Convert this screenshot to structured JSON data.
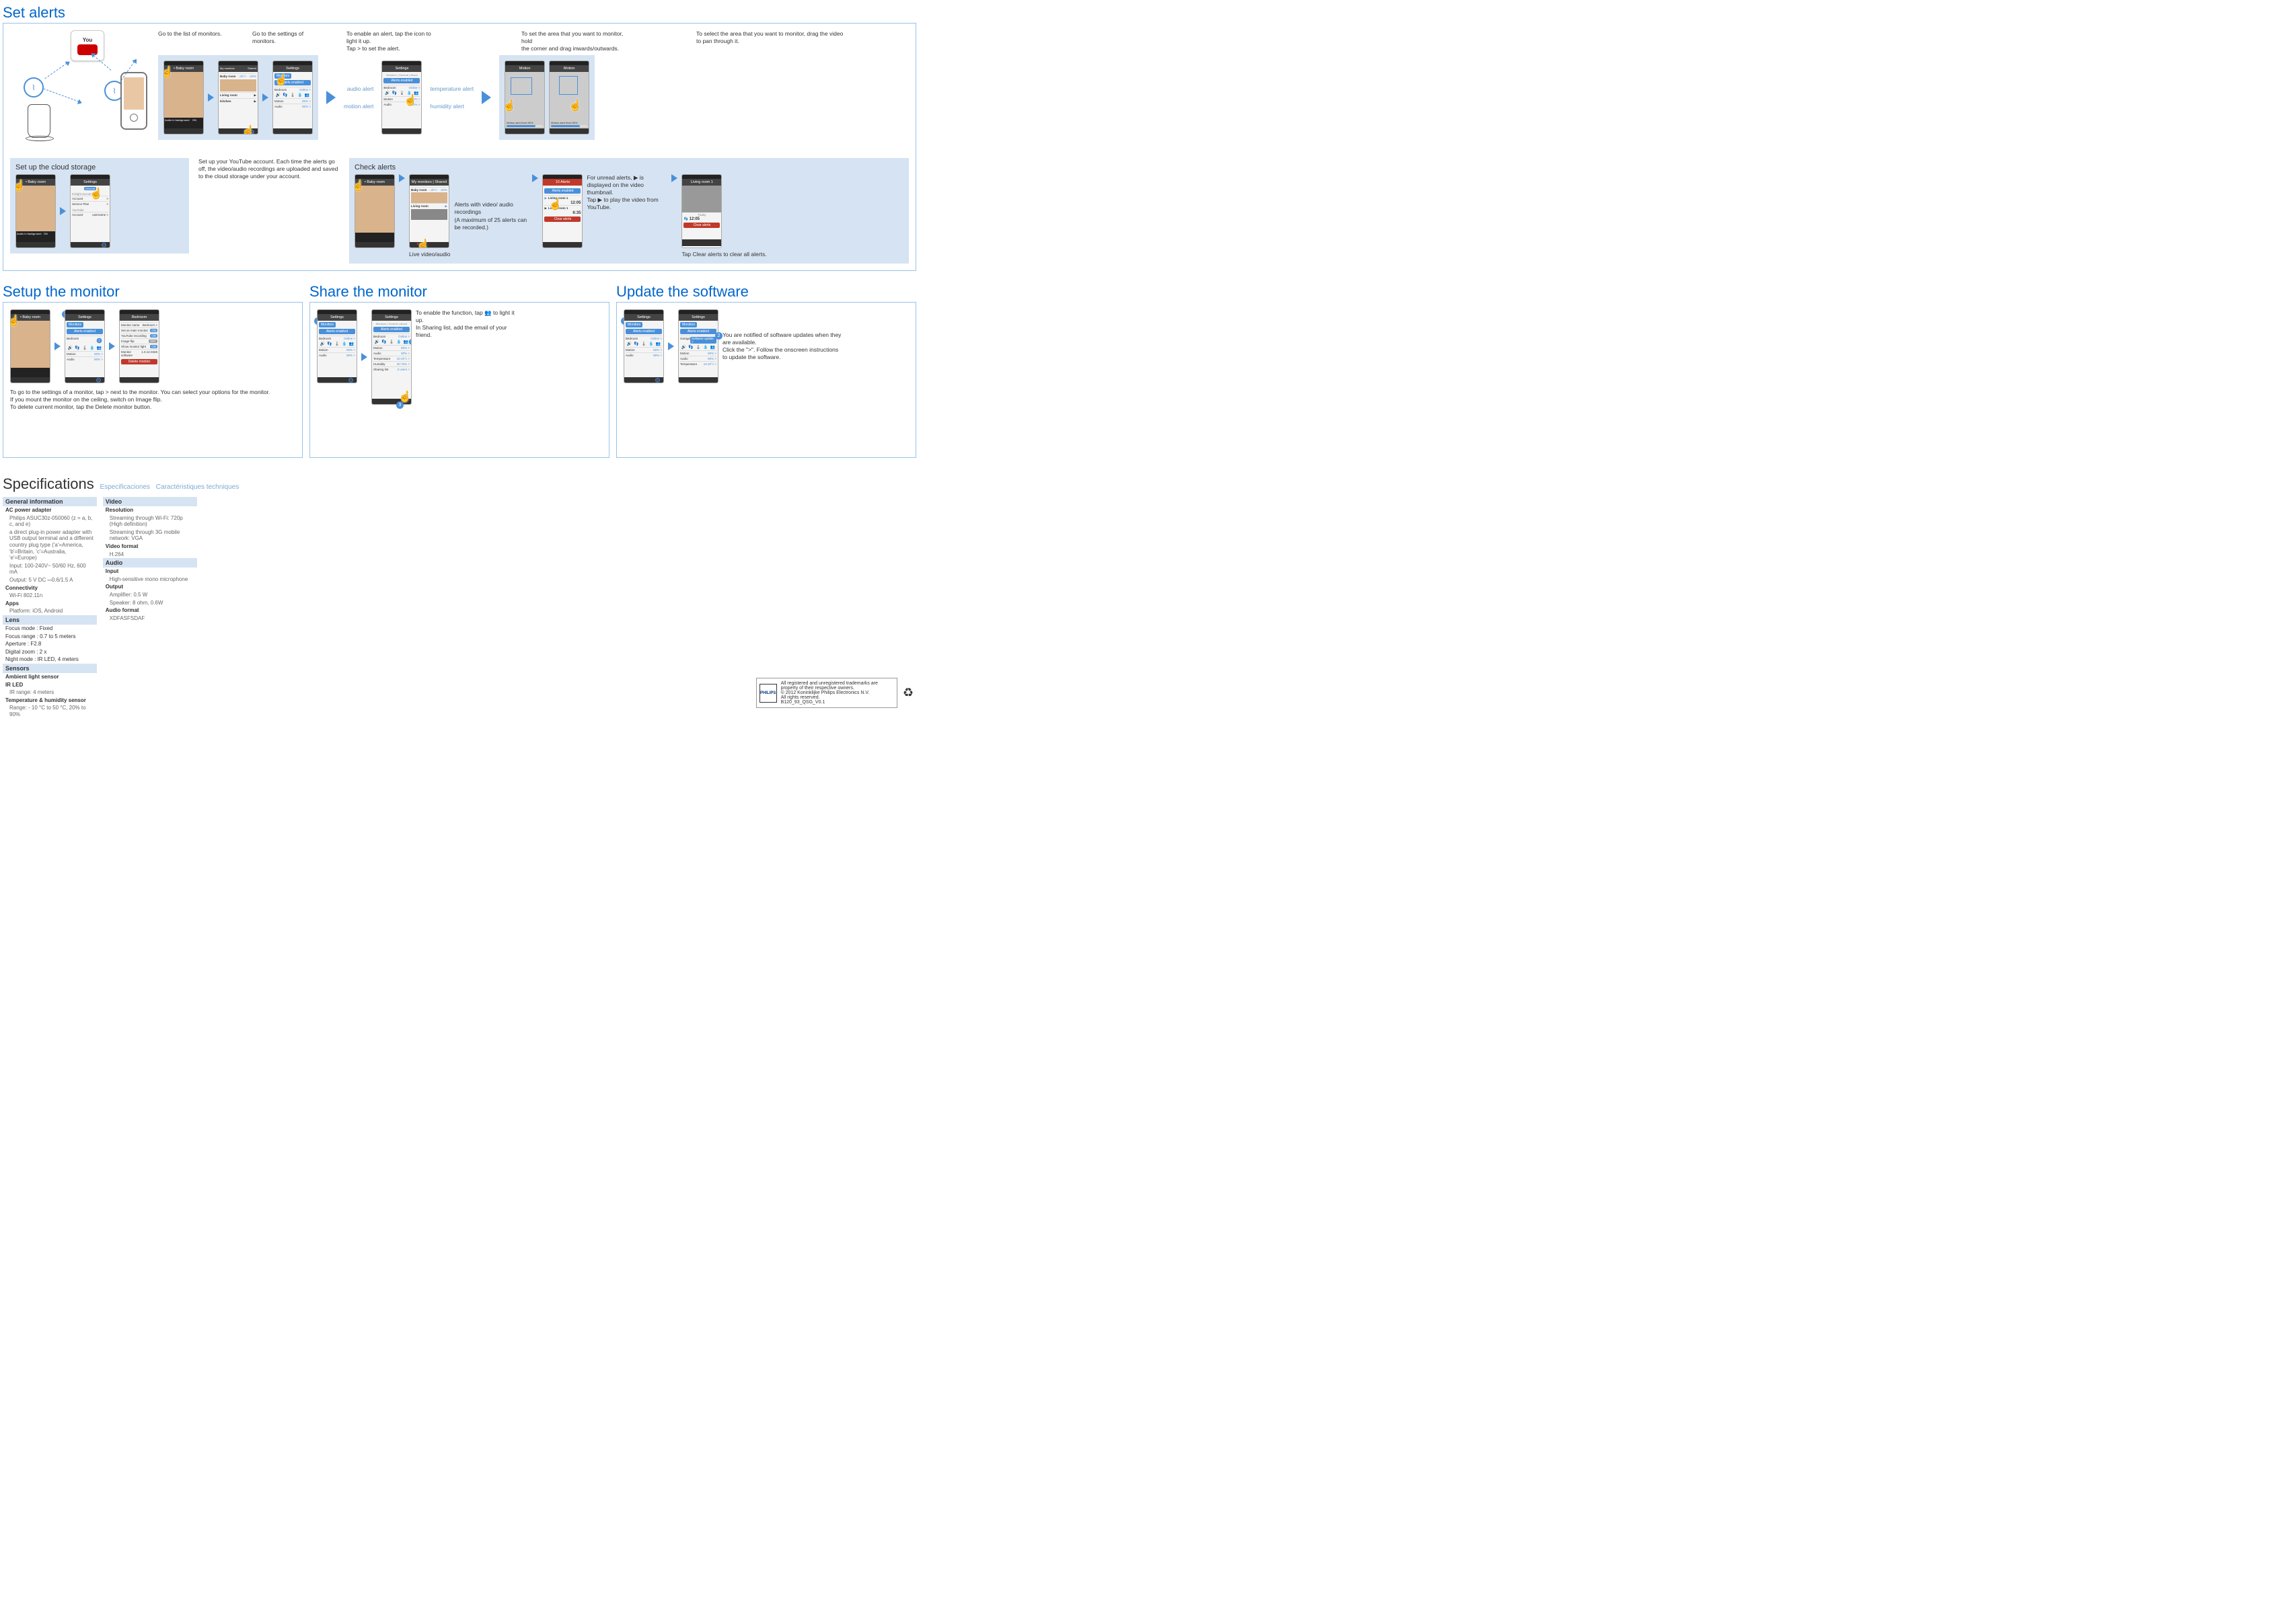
{
  "sections": {
    "set_alerts": {
      "title": "Set alerts",
      "step1": "Go to the list of monitors.",
      "step2": "Go to the settings of monitors.",
      "step3a": "To enable an alert, tap the icon to light it up.",
      "step3b": "Tap > to set the alert.",
      "step4a": "To set the area that you want to monitor, hold",
      "step4b": "the corner and drag inwards/outwards.",
      "step5": "To select the area that you want to monitor,  drag the video to pan through it.",
      "labels": {
        "audio_alert": "audio alert",
        "motion_alert": "motion alert",
        "temperature_alert": "temperature alert",
        "humidity_alert": "humidity alert"
      },
      "phones": {
        "baby_room": "• Baby room",
        "settings": "Settings",
        "monitors": "Monitors",
        "alerts_enabled": "Alerts enabled",
        "bedroom": "Bedroom",
        "online": "Online >",
        "motion": "Motion",
        "motion_v": "80% >",
        "audio": "Audio",
        "audio_v": "80% >",
        "motion_title": "Motion",
        "motion_alert_level": "Motion alert level",
        "level": "80%",
        "list_baby": "Baby room",
        "list_living": "Living room",
        "list_kitchen": "Kitchen",
        "temp_hum": "↓25°c · ↓50%"
      },
      "cloud": {
        "title": "Set up the cloud storage",
        "desc": "Set up your YouTube account. Each time the alerts go off, the video/audio recordings are uploaded and saved to the cloud storage under your account.",
        "general": "General",
        "insight_plan": "InSight account",
        "account": "Account",
        "service_plan": "Service Plan",
        "youtube": "YouTube",
        "account2": "Account",
        "username": "username >"
      },
      "check": {
        "title": "Check alerts",
        "alerts_note": "Alerts with video/ audio recordings",
        "alerts_note2": "(A maximum of 25 alerts can be recorded.)",
        "live": "Live video/audio",
        "unread1": "For unread alerts, ▶ is displayed on the video thumbnail.",
        "unread2": "Tap ▶ to play the video from YouTube.",
        "clear_tip": "Tap Clear alerts to clear all alerts.",
        "ten_alerts": "10 Alerts",
        "living1": "Living room 1",
        "time1": "12:05",
        "time2": "6:35",
        "today": "Today",
        "clear": "Clear alerts"
      }
    },
    "setup_monitor": {
      "title": "Setup the monitor",
      "tip1": "To go to the settings of a monitor, tap > next to the monitor. You can select your options for the monitor.",
      "tip2": "If you mount the monitor on the ceiling, switch on Image flip.",
      "tip3": "To delete current monitor, tap the Delete monitor button.",
      "details": {
        "title": "Bedroom",
        "monitor_name": "Monitor name",
        "monitor_name_v": "Bedroom >",
        "main": "Set as main monitor",
        "main_v": "ON",
        "yt": "YouTube recording",
        "yt_v": "ON",
        "flip": "Image flip",
        "flip_v": "OFF",
        "light": "Show monitor light",
        "light_v": "ON",
        "sw": "Monitor software",
        "sw_v": "1.0.12.0326",
        "delete": "Delete monitor"
      }
    },
    "share_monitor": {
      "title": "Share the monitor",
      "tip1": "To enable the function,  tap  👥  to light it up.",
      "tip2": "In Sharing list, add the email of your friend.",
      "extra": {
        "temperature": "Temperature",
        "temperature_v": "10-20°c >",
        "humidity": "Humidity",
        "humidity_v": "30-70% >",
        "sharing": "Sharing list",
        "sharing_v": "3 users >"
      }
    },
    "update_software": {
      "title": "Update the software",
      "tip1": "You are notified of software updates when they are available.",
      "tip2": "Click the \">\".  Follow the onscreen instructions to update the software.",
      "garage": "Garage",
      "update_btn": "Software update >"
    },
    "specs": {
      "title": "Specifications",
      "es": "Especificaciones",
      "fr": "Caractéristiques techniques",
      "general": {
        "head": "General information",
        "ac": "AC power adapter",
        "ac_l1": "Philips ASUC30z-050060 (z = a, b, c, and e)",
        "ac_l2": "a direct plug-in power adapter with USB output terminal and a different country plug type  ('a'=America, 'b'=Britain, 'c'=Australia, 'e'=Europe)",
        "ac_l3": "Input: 100-240V~ 50/60 Hz, 600 mA",
        "ac_l4": "Output:  5 V DC ⎓0.6/1.5 A",
        "conn": "Connectivity",
        "conn_v": "Wi-Fi 802.11n",
        "apps": "Apps",
        "apps_v": "Platform: iOS, Android"
      },
      "lens": {
        "head": "Lens",
        "focus_mode": "Focus mode : Fixed",
        "focus_range": "Focus range : 0.7 to 5 meters",
        "aperture": "Aperture : F2.8",
        "zoom": "Digital zoom : 2 x",
        "night": "Night mode : IR LED, 4 meters"
      },
      "sensors": {
        "head": "Sensors",
        "ambient": "Ambient light sensor",
        "irled": "IR LED",
        "irled_v": "IR range: 4 meters",
        "temp": "Temperature & humidity sensor",
        "temp_v": "Range: - 10 °C to 50 °C, 20% to 90%"
      },
      "video": {
        "head": "Video",
        "res": "Resolution",
        "res_l1": "Streaming through Wi-Fi: 720p (High definition)",
        "res_l2": "Streaming through 3G mobile network: VGA",
        "fmt": "Video format",
        "fmt_v": "H.264"
      },
      "audio": {
        "head": "Audio",
        "input": "Input",
        "input_v": "High-sensitive mono microphone",
        "output": "Output",
        "out_l1": "Amplifier: 0.5 W",
        "out_l2": "Speaker: 8 ohm, 0.6W",
        "afmt": "Audio format",
        "afmt_v": "XDFASFSDAF"
      }
    },
    "footer": {
      "line1": "All registered and unregistered trademarks are property of their respective owners.",
      "line2": "© 2012 Koninklijke Philips Electronics N.V.",
      "line3": "All rights reserved.",
      "line4": "B120_93_QSG_V0.1",
      "logo": "PHILIPS"
    }
  }
}
